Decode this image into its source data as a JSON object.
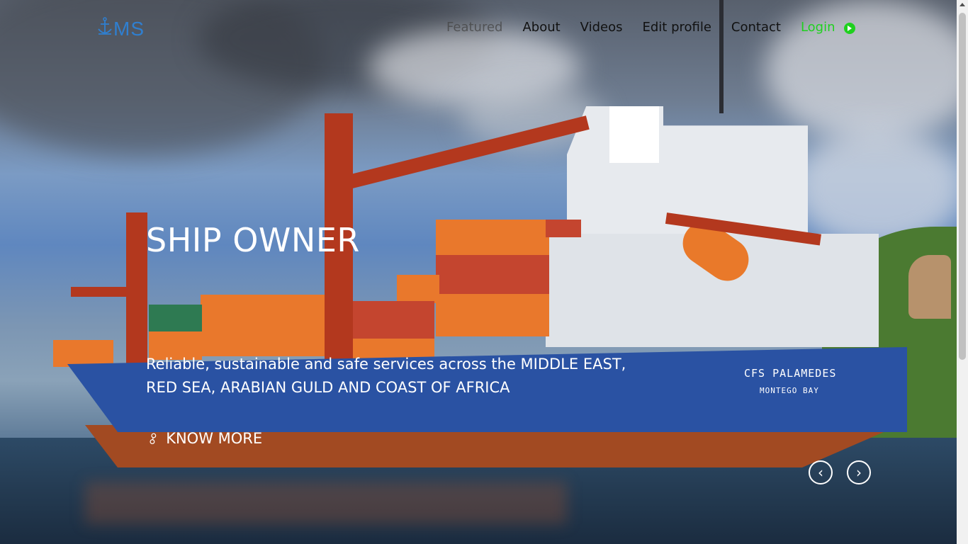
{
  "logo": {
    "text": "MS",
    "icon": "anchor-icon"
  },
  "nav": {
    "items": [
      {
        "label": "Featured",
        "active": true
      },
      {
        "label": "About"
      },
      {
        "label": "Videos"
      },
      {
        "label": "Edit profile"
      },
      {
        "label": "Contact"
      }
    ],
    "login": {
      "label": "Login",
      "icon": "login-arrow-icon",
      "color": "#1fd11f"
    }
  },
  "hero": {
    "title": "SHIP OWNER",
    "text": "Reliable, sustainable and safe services across the MIDDLE EAST, RED SEA, ARABIAN GULD AND COAST OF AFRICA",
    "cta": {
      "label": "KNOW MORE",
      "icon": "link-icon"
    },
    "ship_name": "CFS PALAMEDES",
    "ship_port": "MONTEGO BAY",
    "prev_icon": "chevron-left-icon",
    "next_icon": "chevron-right-icon"
  },
  "colors": {
    "logo": "#2f7fd0",
    "login": "#1fd11f",
    "hull": "#2a52a3"
  }
}
